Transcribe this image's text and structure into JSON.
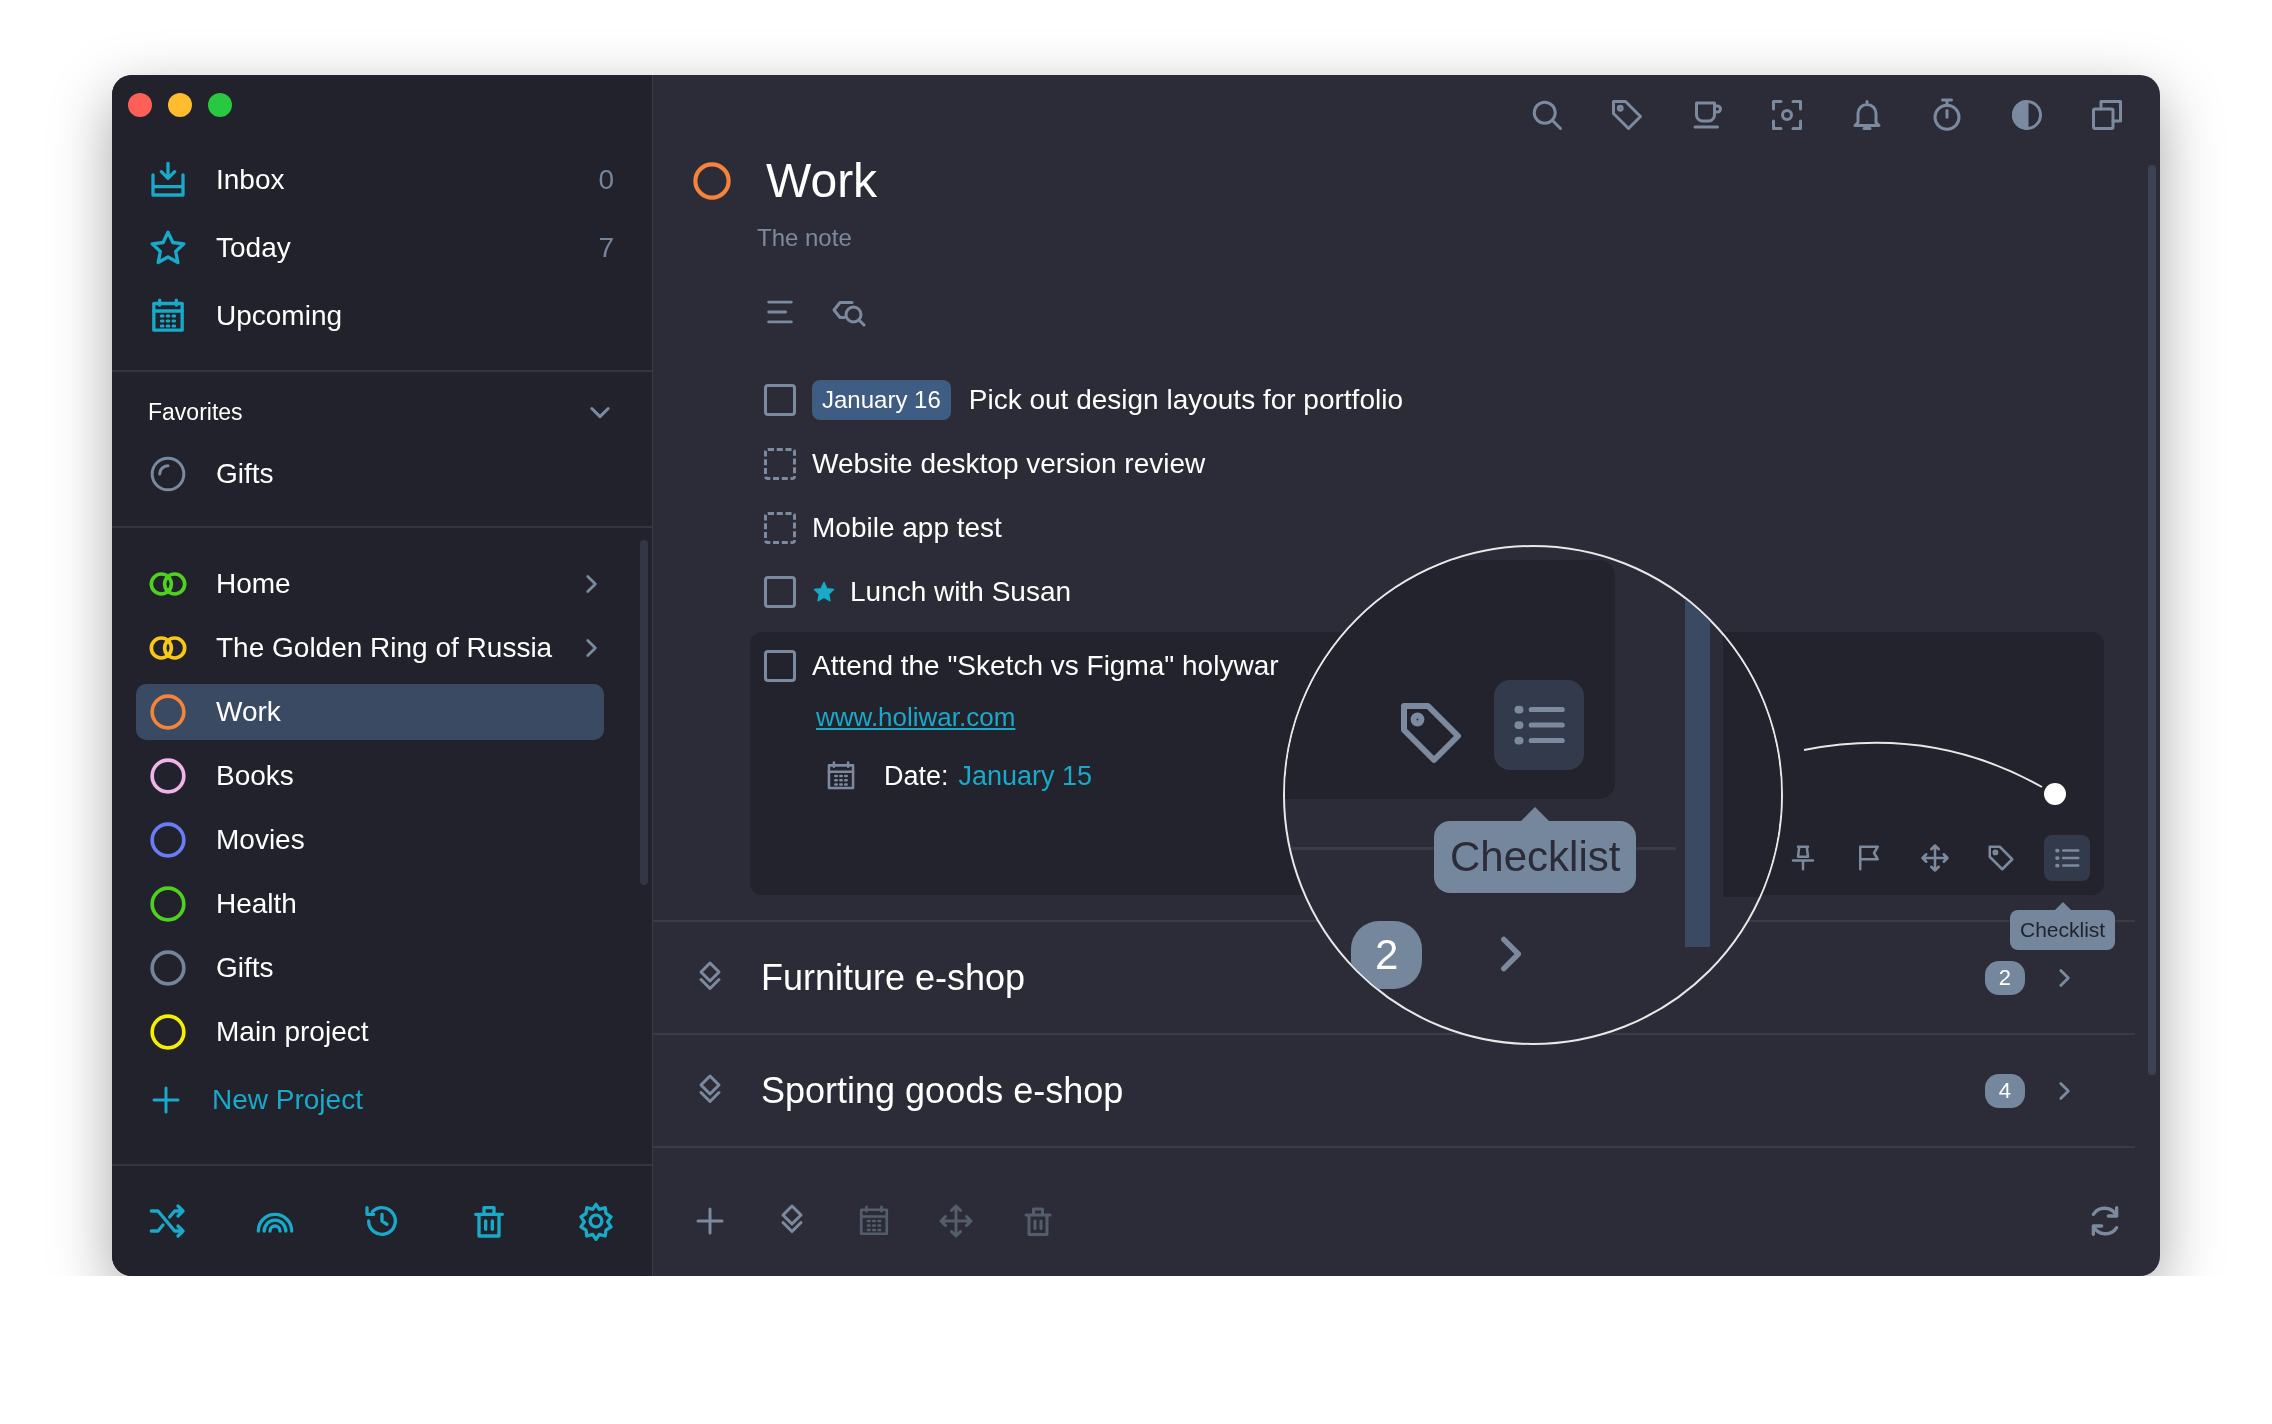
{
  "sidebar": {
    "nav": [
      {
        "kind": "inbox",
        "label": "Inbox",
        "count": "0"
      },
      {
        "kind": "today",
        "label": "Today",
        "count": "7"
      },
      {
        "kind": "upcoming",
        "label": "Upcoming"
      }
    ],
    "favorites": {
      "title": "Favorites",
      "expanded": true,
      "items": [
        {
          "label": "Gifts"
        }
      ]
    },
    "projects": [
      {
        "label": "Home",
        "kind": "area",
        "color": "#4fd11f",
        "selected": false
      },
      {
        "label": "The Golden Ring of Russia",
        "kind": "area",
        "color": "#f7c815",
        "selected": false
      },
      {
        "label": "Work",
        "kind": "project",
        "color": "#f5843a",
        "selected": true
      },
      {
        "label": "Books",
        "kind": "project",
        "color": "#f0b4ea",
        "selected": false
      },
      {
        "label": "Movies",
        "kind": "project",
        "color": "#6a7df6",
        "selected": false
      },
      {
        "label": "Health",
        "kind": "project",
        "color": "#4fd11f",
        "selected": false
      },
      {
        "label": "Gifts",
        "kind": "project",
        "color": "#74849a",
        "selected": false
      },
      {
        "label": "Main project",
        "kind": "project",
        "color": "#f5ef00",
        "selected": false
      }
    ],
    "new_project": "New Project"
  },
  "main": {
    "title": "Work",
    "color": "#f5843a",
    "note": "The note",
    "tasks": [
      {
        "kind": "solid",
        "checked": false,
        "date_tag": "January 16",
        "title": "Pick out design layouts for portfolio",
        "starred": false,
        "expanded": false
      },
      {
        "kind": "dashed",
        "checked": false,
        "title": "Website desktop version review",
        "starred": false,
        "expanded": false
      },
      {
        "kind": "dashed",
        "checked": false,
        "title": "Mobile app test",
        "starred": false,
        "expanded": false
      },
      {
        "kind": "solid",
        "checked": false,
        "title": "Lunch with Susan",
        "starred": true,
        "expanded": false
      },
      {
        "kind": "solid",
        "checked": false,
        "title": "Attend the \"Sketch vs Figma\" holywar",
        "starred": false,
        "expanded": true,
        "link": "www.holiwar.com",
        "date_label": "Date:",
        "date_value": "January 15",
        "tools": [
          {
            "kind": "pin",
            "selected": false
          },
          {
            "kind": "flag",
            "selected": false
          },
          {
            "kind": "move",
            "selected": false
          },
          {
            "kind": "tag",
            "selected": false
          },
          {
            "kind": "checklist",
            "selected": true
          }
        ],
        "tooltip": "Checklist"
      }
    ],
    "sections": [
      {
        "title": "Furniture e-shop",
        "count": "2"
      },
      {
        "title": "Sporting goods e-shop",
        "count": "4"
      }
    ]
  },
  "magnifier": {
    "tooltip": "Checklist",
    "count": "2"
  }
}
